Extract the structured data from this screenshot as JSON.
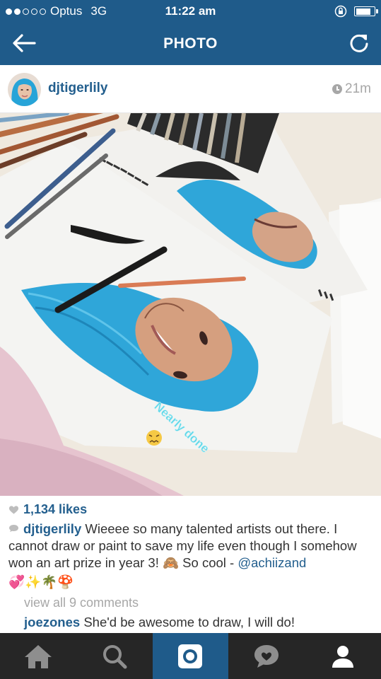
{
  "status_bar": {
    "carrier": "Optus",
    "network": "3G",
    "time": "11:22 am",
    "signal_bars_filled": 2,
    "signal_bars_total": 5,
    "battery_level": 0.85
  },
  "nav": {
    "title": "PHOTO",
    "back_icon": "arrow-left-icon",
    "refresh_icon": "refresh-icon"
  },
  "post": {
    "username": "djtigerlily",
    "time_ago": "21m",
    "photo_overlay_text": "Nearly done",
    "likes": "1,134 likes",
    "caption": {
      "username": "djtigerlily",
      "text": "Wieeee so many talented artists out there. I cannot draw or paint to save my life even though I somehow won an art prize in year 3! 🙈 So cool -",
      "mention": "@achiizand",
      "emojis": "💞✨🌴🍄"
    },
    "view_all": "view all 9 comments",
    "comments": [
      {
        "username": "joezones",
        "text": "She'd be awesome to draw, I will do!"
      }
    ]
  },
  "tabbar": {
    "tabs": [
      {
        "icon": "home-icon"
      },
      {
        "icon": "search-icon"
      },
      {
        "icon": "camera-icon",
        "active": true
      },
      {
        "icon": "activity-icon"
      },
      {
        "icon": "profile-icon"
      }
    ]
  },
  "colors": {
    "header_blue": "#1f5b8a",
    "link_blue": "#235f8e",
    "tabbar": "#262626",
    "hair_blue": "#2fa6d9"
  }
}
